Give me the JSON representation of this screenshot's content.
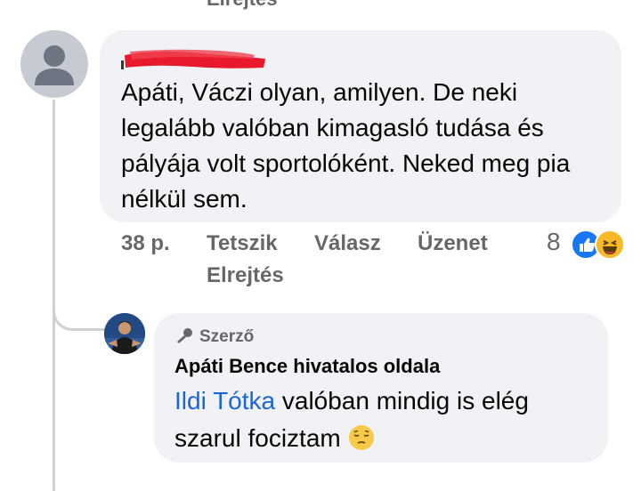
{
  "top_cut_label": "Elrejtés",
  "comment1": {
    "text": "Apáti, Váczi olyan, amilyen. De neki legalább valóban kimagasló tudása és pályája volt sportolóként. Neked meg pia nélkül sem.",
    "time": "38 p.",
    "actions": {
      "like": "Tetszik",
      "reply": "Válasz",
      "message": "Üzenet",
      "hide": "Elrejtés"
    },
    "reaction_count": "8",
    "reactions": [
      "like-icon",
      "haha-icon"
    ]
  },
  "reply": {
    "badge": "Szerző",
    "page_name": "Apáti Bence hivatalos oldala",
    "mention": "Ildi Tótka",
    "text_line1": " valóban mindig is elég",
    "text_line2": "szarul fociztam",
    "emoji": "pensive-face-icon"
  },
  "colors": {
    "bubble": "#f0f2f5",
    "mention": "#1a66d6",
    "muted": "#65676b",
    "like": "#1877f2",
    "redaction": "#e8192c"
  }
}
